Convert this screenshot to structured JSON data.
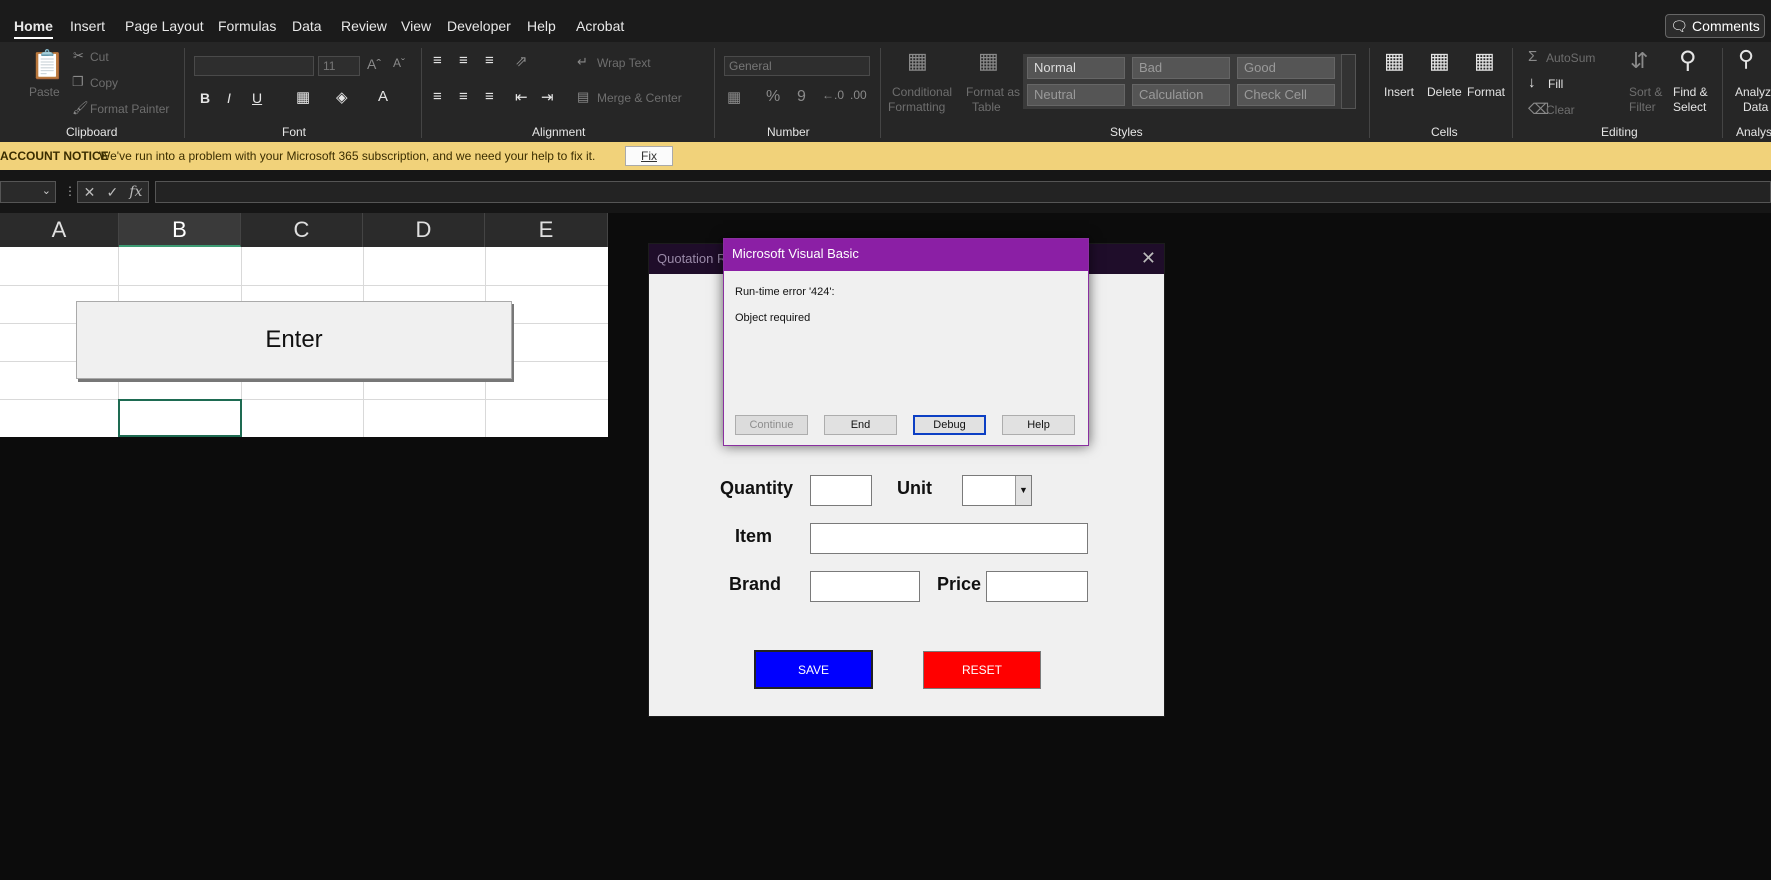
{
  "menu": {
    "tabs": [
      "Home",
      "Insert",
      "Page Layout",
      "Formulas",
      "Data",
      "Review",
      "View",
      "Developer",
      "Help",
      "Acrobat"
    ],
    "comments_label": "Comments"
  },
  "ribbon": {
    "clipboard": {
      "paste": "Paste",
      "cut": "Cut",
      "copy": "Copy",
      "format_painter": "Format Painter",
      "label": "Clipboard"
    },
    "font": {
      "size": "11",
      "bold": "B",
      "italic": "I",
      "underline": "U",
      "label": "Font"
    },
    "alignment": {
      "wrap_text": "Wrap Text",
      "merge_center": "Merge & Center",
      "label": "Alignment"
    },
    "number": {
      "format": "General",
      "percent": "%",
      "comma": "9",
      "label": "Number"
    },
    "styles": {
      "conditional": "Conditional",
      "formatting": "Formatting",
      "format_as": "Format as",
      "table": "Table",
      "cells": [
        {
          "name": "Normal",
          "bg": "#565656",
          "color": "#ffffff"
        },
        {
          "name": "Bad",
          "bg": "#5a5a5a",
          "color": "#9a9a9a"
        },
        {
          "name": "Good",
          "bg": "#5a5a5a",
          "color": "#9a9a9a"
        },
        {
          "name": "Neutral",
          "bg": "#5a5a5a",
          "color": "#9a9a9a"
        },
        {
          "name": "Calculation",
          "bg": "#5a5a5a",
          "color": "#9a9a9a"
        },
        {
          "name": "Check Cell",
          "bg": "#5a5a5a",
          "color": "#9a9a9a"
        }
      ],
      "label": "Styles"
    },
    "cells": {
      "insert": "Insert",
      "delete": "Delete",
      "format": "Format",
      "label": "Cells"
    },
    "editing": {
      "autosum": "AutoSum",
      "fill": "Fill",
      "clear": "Clear",
      "sort_filter_1": "Sort &",
      "sort_filter_2": "Filter",
      "find_select_1": "Find &",
      "find_select_2": "Select",
      "label": "Editing"
    },
    "analysis": {
      "analyze_1": "Analyz",
      "analyze_2": "Data",
      "label": "Analysis"
    }
  },
  "notice": {
    "title": "ACCOUNT NOTICE",
    "message": "We've run into a problem with your Microsoft 365 subscription, and we need your help to fix it.",
    "fix_label": "Fix"
  },
  "formula_bar": {
    "fx": "fx",
    "value": ""
  },
  "sheet": {
    "columns": [
      "A",
      "B",
      "C",
      "D",
      "E"
    ],
    "selected_column": "B",
    "enter_button": "Enter"
  },
  "userform": {
    "title": "Quotation Re",
    "quantity_label": "Quantity",
    "unit_label": "Unit",
    "item_label": "Item",
    "brand_label": "Brand",
    "price_label": "Price",
    "save_label": "SAVE",
    "reset_label": "RESET",
    "save_color": "#0000ff",
    "reset_color": "#ff0000"
  },
  "vba_dialog": {
    "title": "Microsoft Visual Basic",
    "error_line": "Run-time error '424':",
    "message": "Object required",
    "buttons": {
      "continue": "Continue",
      "end": "End",
      "debug": "Debug",
      "help": "Help"
    },
    "title_color": "#8b1fa5"
  }
}
